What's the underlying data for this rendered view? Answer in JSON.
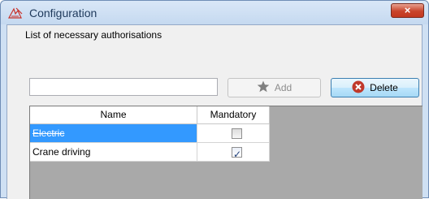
{
  "window": {
    "title": "Configuration",
    "close_label": "×"
  },
  "form": {
    "list_label": "List of necessary authorisations",
    "input_value": "",
    "add_label": "Add",
    "delete_label": "Delete"
  },
  "table": {
    "columns": [
      "Name",
      "Mandatory"
    ],
    "rows": [
      {
        "name": "Electric",
        "mandatory": false,
        "selected": true
      },
      {
        "name": "Crane driving",
        "mandatory": true,
        "selected": false
      }
    ]
  },
  "icons": {
    "title": "pencil-triangle-icon",
    "add": "star-icon",
    "delete": "delete-x-icon",
    "checked": "checkmark-icon"
  },
  "colors": {
    "selection": "#3399ff",
    "grid_background": "#a9a9a9",
    "close_button": "#c9442b"
  }
}
